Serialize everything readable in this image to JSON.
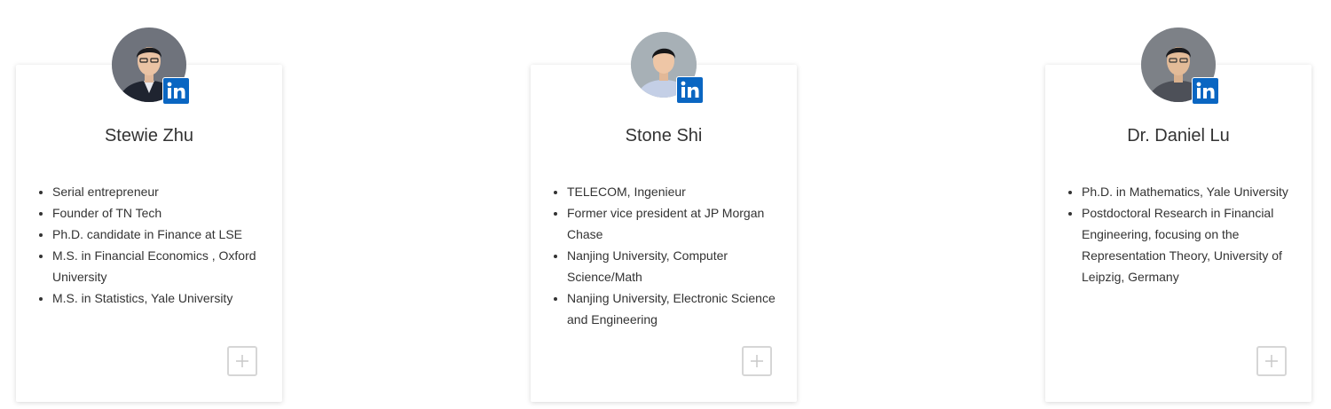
{
  "members": [
    {
      "name": "Stewie Zhu",
      "avatar_icon": "portrait-photo",
      "social_icon": "linkedin-icon",
      "bio": [
        "Serial entrepreneur",
        "Founder of TN Tech",
        "Ph.D. candidate in Finance at LSE",
        "M.S. in Financial Economics , Oxford University",
        "M.S. in Statistics, Yale University"
      ]
    },
    {
      "name": "Stone Shi",
      "avatar_icon": "portrait-photo",
      "social_icon": "linkedin-icon",
      "bio": [
        "TELECOM, Ingenieur",
        "Former vice president at JP Morgan Chase",
        "Nanjing University, Computer Science/Math",
        "Nanjing University, Electronic Science and Engineering"
      ]
    },
    {
      "name": "Dr. Daniel Lu",
      "avatar_icon": "portrait-photo",
      "social_icon": "linkedin-icon",
      "bio": [
        "Ph.D. in Mathematics, Yale University",
        "Postdoctoral Research in Financial Engineering, focusing on the Representation Theory, University of Leipzig, Germany"
      ]
    }
  ],
  "colors": {
    "linkedin_blue": "#0a66c2",
    "text": "#333333",
    "button_border": "#d6d6d6"
  }
}
